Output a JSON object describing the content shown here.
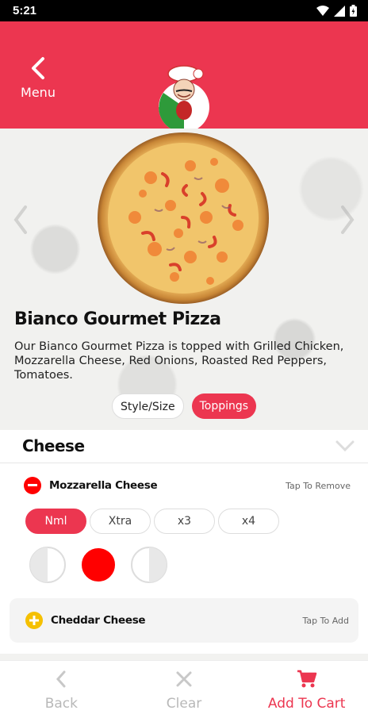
{
  "status_bar": {
    "time": "5:21"
  },
  "header": {
    "back_label": "Menu"
  },
  "product": {
    "name": "Bianco Gourmet Pizza",
    "description": "Our Bianco Gourmet Pizza is topped with Grilled Chicken, Mozzarella Cheese, Red Onions, Roasted Red Peppers, Tomatoes."
  },
  "tabs": [
    {
      "label": "Style/Size",
      "active": false
    },
    {
      "label": "Toppings",
      "active": true
    }
  ],
  "section": {
    "title": "Cheese"
  },
  "toppings": [
    {
      "name": "Mozzarella Cheese",
      "hint": "Tap To Remove",
      "selected": true,
      "quantities": [
        {
          "label": "Nml",
          "selected": true
        },
        {
          "label": "Xtra",
          "selected": false
        },
        {
          "label": "x3",
          "selected": false
        },
        {
          "label": "x4",
          "selected": false
        }
      ],
      "coverage": [
        "left-half",
        "whole",
        "right-half"
      ],
      "coverage_selected": "whole"
    },
    {
      "name": "Cheddar Cheese",
      "hint": "Tap To Add",
      "selected": false
    }
  ],
  "bottom_bar": {
    "back_label": "Back",
    "clear_label": "Clear",
    "add_label": "Add To Cart"
  },
  "colors": {
    "brand": "#ec3650",
    "selected_red": "#ff0000",
    "add_yellow": "#f5c000",
    "disabled_grey": "#b8b8b8"
  }
}
